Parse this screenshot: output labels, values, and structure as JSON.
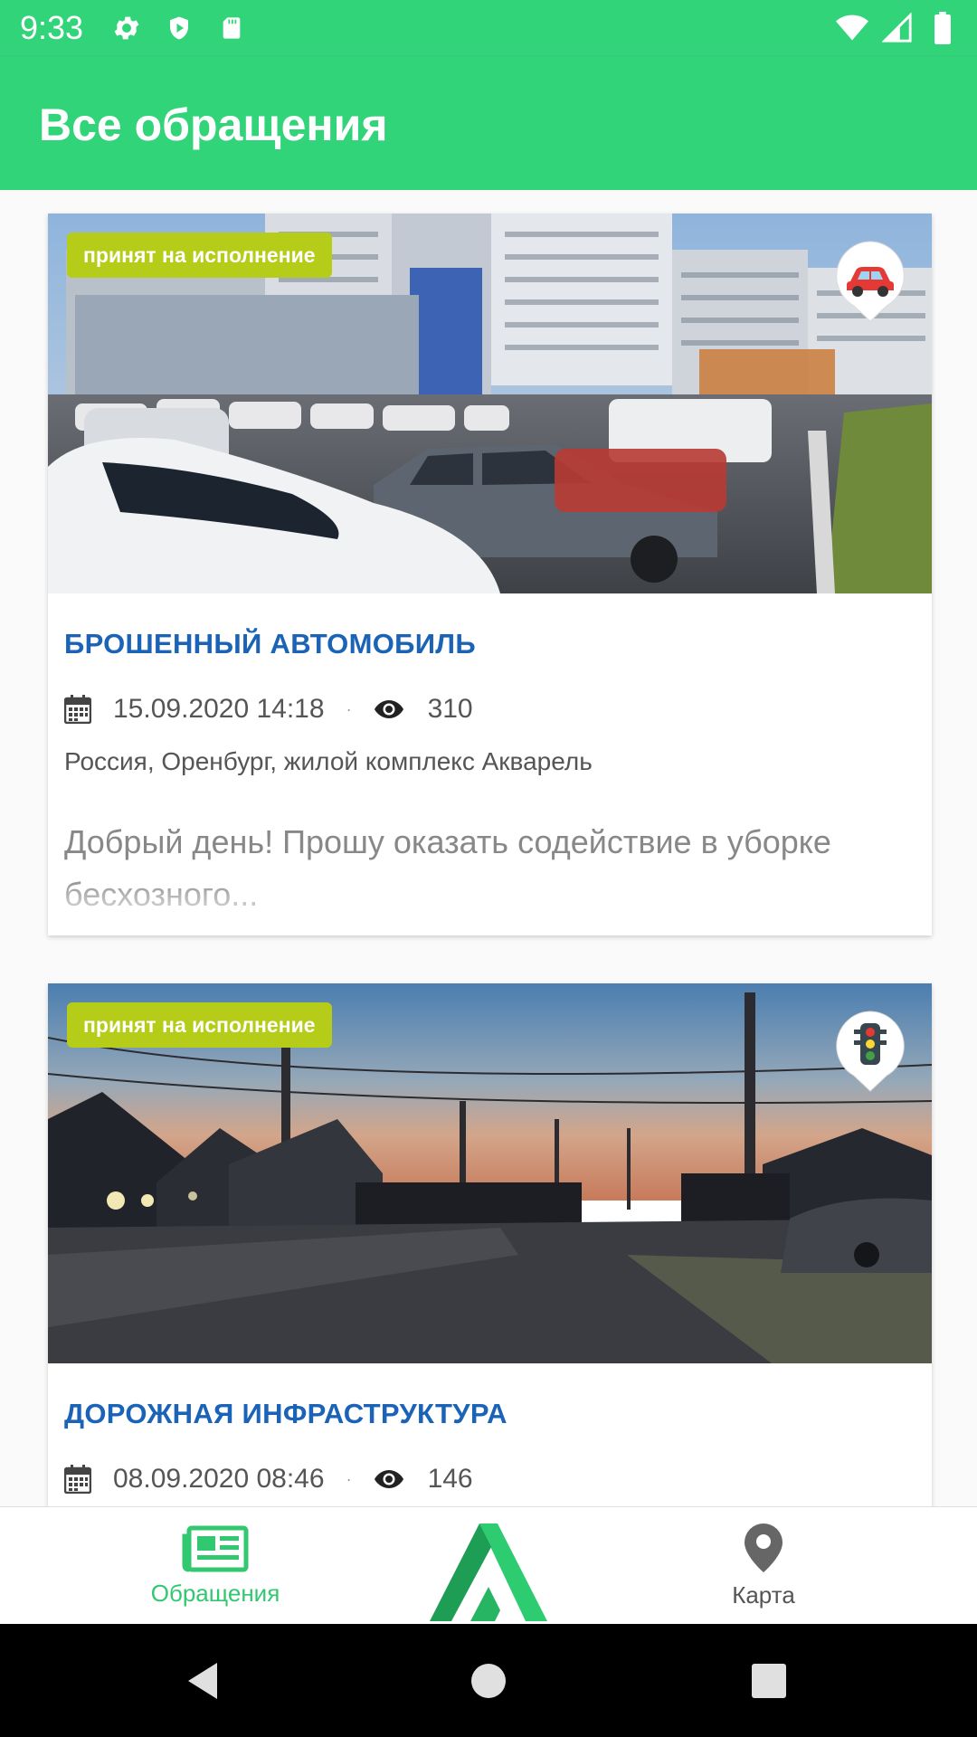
{
  "status_bar": {
    "time": "9:33",
    "left_icons": [
      "gear-icon",
      "shield-icon",
      "sdcard-icon"
    ],
    "right_icons": [
      "wifi-icon",
      "signal-icon",
      "battery-icon"
    ]
  },
  "app_bar": {
    "title": "Все обращения",
    "color": "#32d47a"
  },
  "cards": [
    {
      "status": "принят на исполнение",
      "category_icon": "car-icon",
      "title": "БРОШЕННЫЙ АВТОМОБИЛЬ",
      "date": "15.09.2020 14:18",
      "separator": "·",
      "views": "310",
      "address": "Россия, Оренбург, жилой комплекс Акварель",
      "description": "Добрый день! Прошу оказать содействие в уборке бесхозного..."
    },
    {
      "status": "принят на исполнение",
      "category_icon": "traffic-light-icon",
      "title": "ДОРОЖНАЯ ИНФРАСТРУКТУРА",
      "date": "08.09.2020 08:46",
      "separator": "·",
      "views": "146"
    }
  ],
  "bottom_nav": {
    "appeals_label": "Обращения",
    "map_label": "Карта",
    "active_color": "#32c870"
  },
  "colors": {
    "status_chip": "#b5cc18",
    "title_blue": "#1b63b7"
  }
}
